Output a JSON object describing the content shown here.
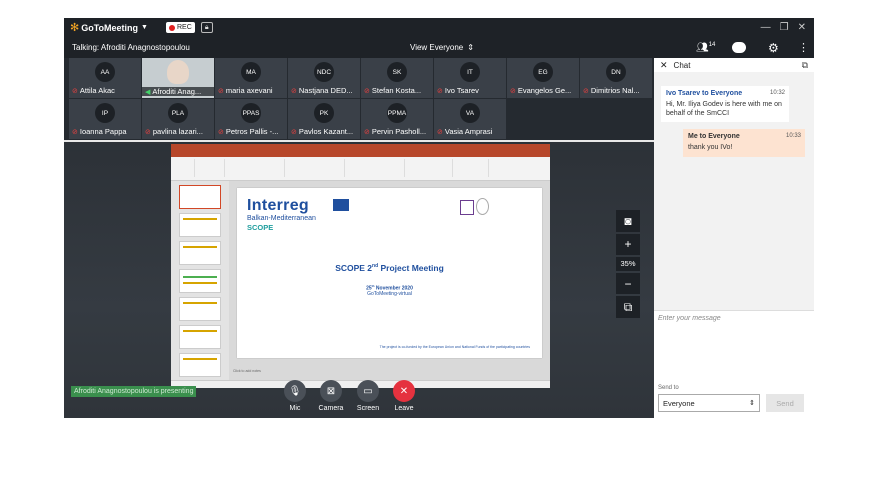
{
  "app": {
    "name": "GoToMeeting",
    "rec_label": "REC"
  },
  "talkbar": {
    "talking": "Talking: Afroditi Anagnostopoulou",
    "view": "View Everyone"
  },
  "header": {
    "participant_count": "14"
  },
  "participants": [
    {
      "initials": "AA",
      "name": "Attila Akac"
    },
    {
      "initials": "",
      "name": "Afroditi Anag..."
    },
    {
      "initials": "MA",
      "name": "maria axevani"
    },
    {
      "initials": "NDC",
      "name": "Nastjana DED..."
    },
    {
      "initials": "SK",
      "name": "Stefan Kosta..."
    },
    {
      "initials": "IT",
      "name": "Ivo Tsarev"
    },
    {
      "initials": "EG",
      "name": "Evangelos Ge..."
    },
    {
      "initials": "DN",
      "name": "Dimitrios Nal..."
    },
    {
      "initials": "IP",
      "name": "Ioanna Pappa"
    },
    {
      "initials": "PLA",
      "name": "pavlina lazari..."
    },
    {
      "initials": "PPAS",
      "name": "Petros Pallis -..."
    },
    {
      "initials": "PK",
      "name": "Pavlos Kazant..."
    },
    {
      "initials": "PPMA",
      "name": "Pervin Pasholl..."
    },
    {
      "initials": "VA",
      "name": "Vasia Amprasi"
    }
  ],
  "slide": {
    "logo_text": "Interreg",
    "program": "Balkan-Mediterranean",
    "project": "SCOPE",
    "title_main": "SCOPE 2",
    "title_sup": "nd",
    "title_rest": " Project Meeting",
    "date_day": "25",
    "date_sup": "th",
    "date_rest": " November 2020",
    "location": "GoToMeeting-virtual",
    "footer": "The project is co-funded by the European Union and National Funds of the participating countries",
    "notes_hint": "Click to add notes"
  },
  "zoom": {
    "percent": "35%"
  },
  "presenting_label": "Afroditi Anagnostopoulou is presenting",
  "controls": {
    "mic": "Mic",
    "camera": "Camera",
    "screen": "Screen",
    "leave": "Leave"
  },
  "chat": {
    "title": "Chat",
    "messages": [
      {
        "from": "Ivo Tsarev to Everyone",
        "time": "10:32",
        "text": "Hi, Mr. Iliya Godev is here with me on behalf of the SmCCI"
      },
      {
        "from": "Me to Everyone",
        "time": "10:33",
        "text": "thank you IVo!"
      }
    ],
    "input_placeholder": "Enter your message",
    "send_to_label": "Send to",
    "send_to_value": "Everyone",
    "send_label": "Send"
  }
}
